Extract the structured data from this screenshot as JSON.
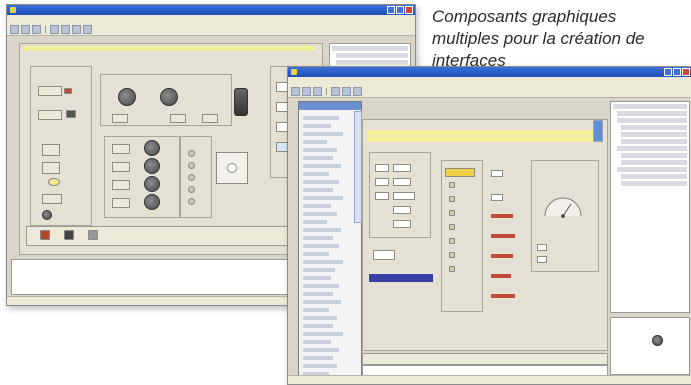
{
  "caption": {
    "line1": "Composants graphiques",
    "line2": "multiples pour la création de",
    "line3": "interfaces"
  },
  "colors": {
    "titlebar": "#2a5cc8",
    "panel": "#e4e0d3",
    "header_yellow": "#f1ef9a",
    "bar_blue": "#3a3fa5",
    "label_red": "#c04a3c"
  },
  "icons": [
    "window-icon",
    "minimize-icon",
    "maximize-icon",
    "close-icon",
    "knob-icon",
    "toggle-switch-icon",
    "led-icon",
    "gauge-icon",
    "dial-icon"
  ]
}
